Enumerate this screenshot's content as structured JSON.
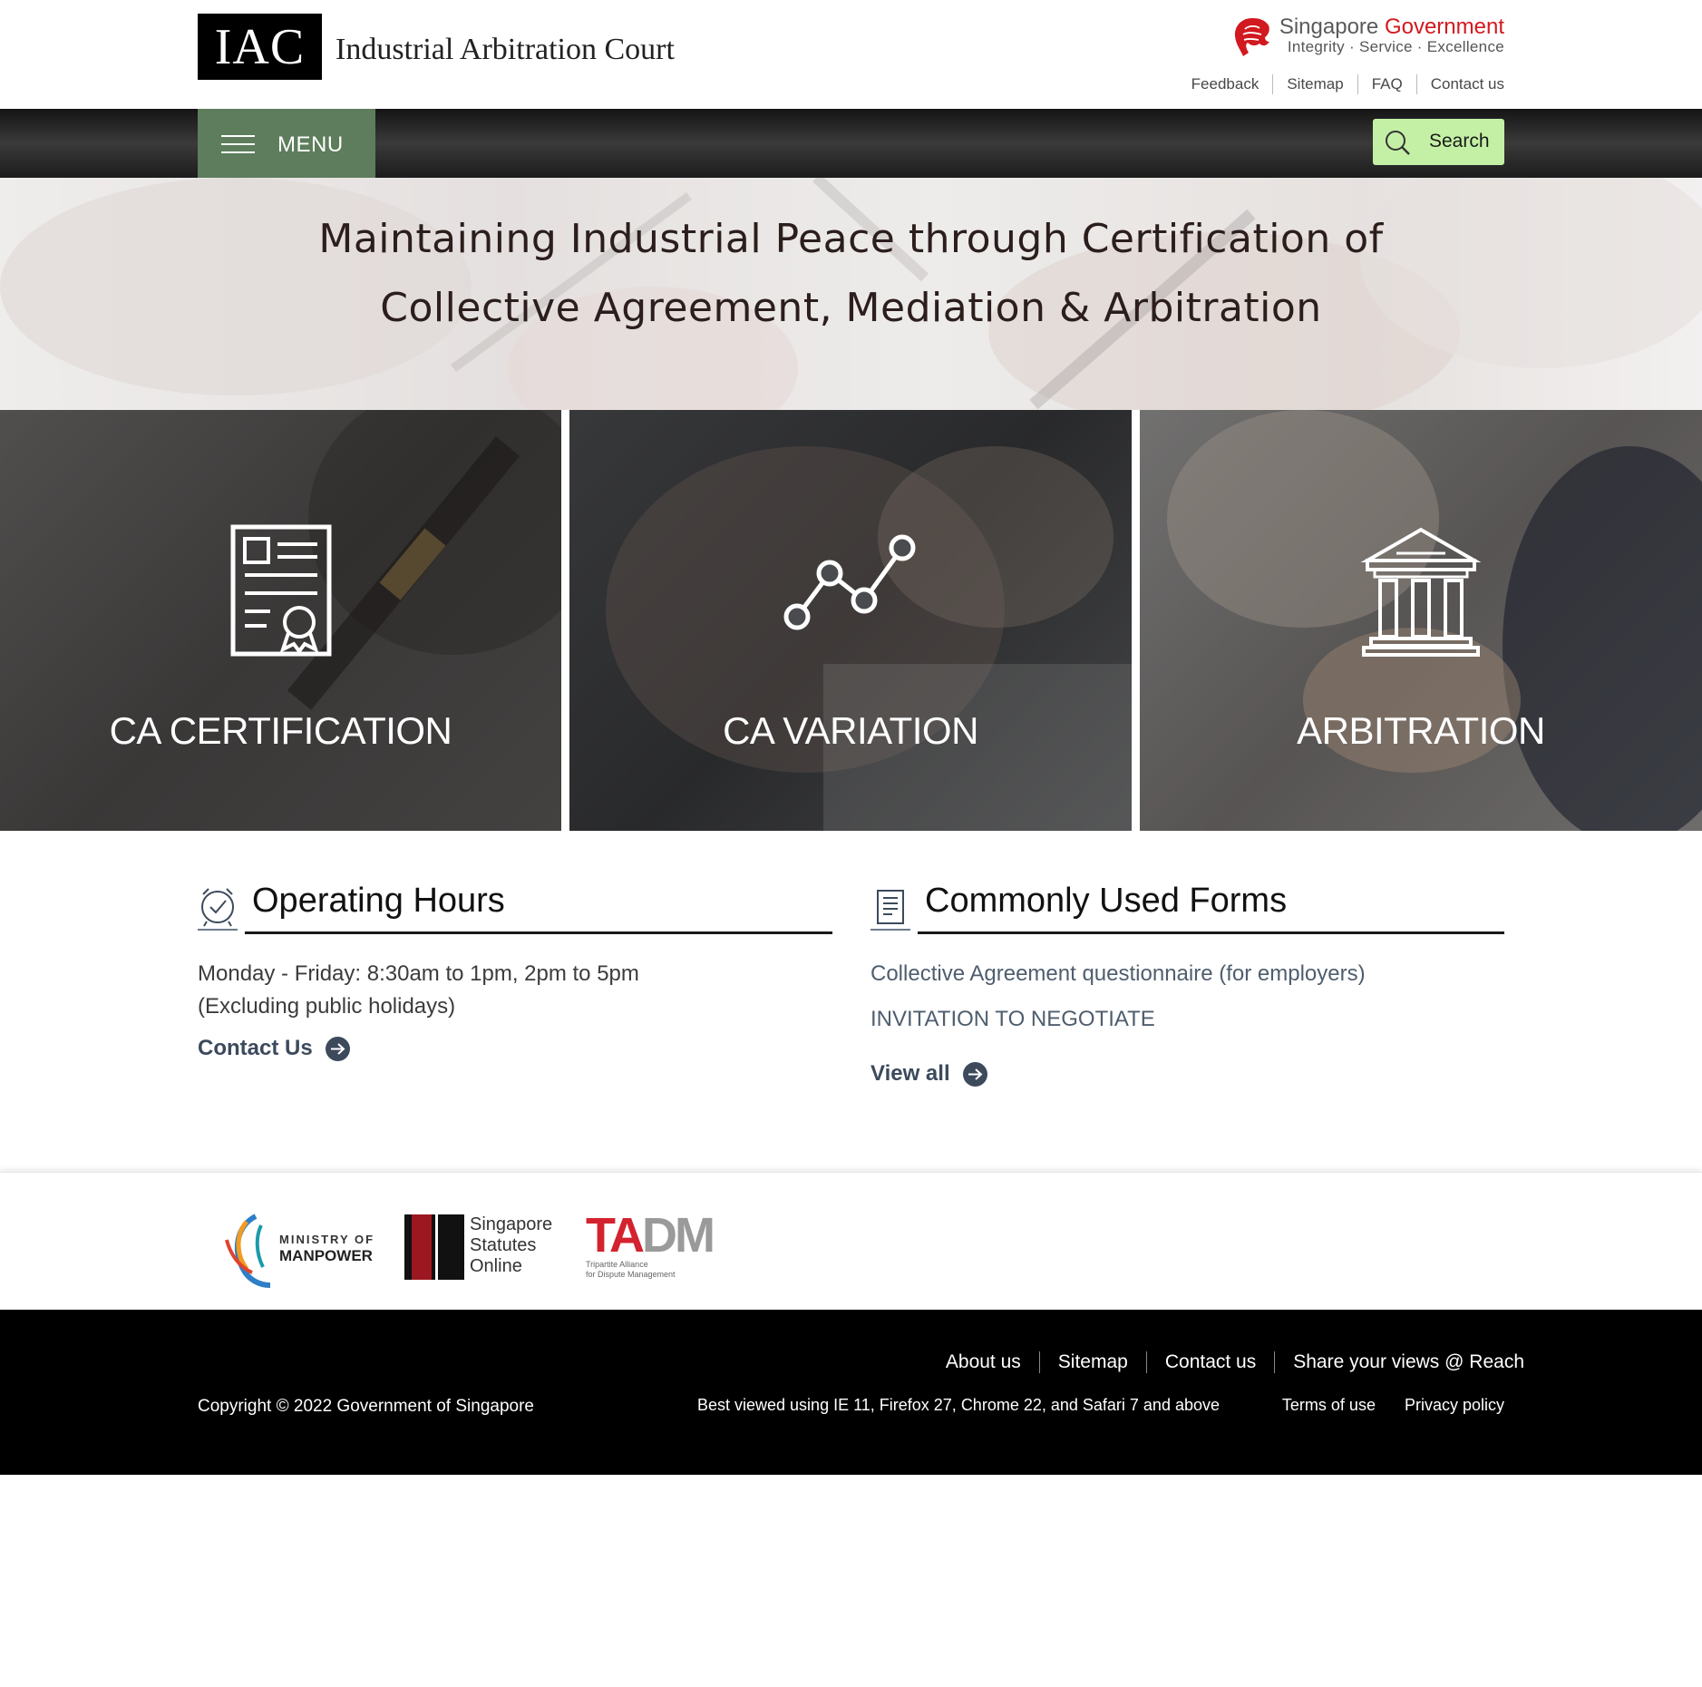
{
  "header": {
    "logo_abbr": "IAC",
    "logo_name": "Industrial Arbitration Court",
    "sg_gov": {
      "title_plain": "Singapore",
      "title_red": "Government",
      "tagline": "Integrity · Service · Excellence"
    },
    "util_links": [
      "Feedback",
      "Sitemap",
      "FAQ",
      "Contact us"
    ]
  },
  "nav": {
    "menu_label": "MENU",
    "search_label": "Search"
  },
  "hero": {
    "line1": "Maintaining Industrial Peace through Certification of",
    "line2": "Collective Agreement, Mediation & Arbitration"
  },
  "tiles": [
    {
      "label": "CA CERTIFICATION",
      "icon": "certificate-icon"
    },
    {
      "label": "CA VARIATION",
      "icon": "line-graph-icon"
    },
    {
      "label": "ARBITRATION",
      "icon": "courthouse-icon"
    }
  ],
  "operating_hours": {
    "title": "Operating Hours",
    "line1": "Monday - Friday: 8:30am to 1pm, 2pm to 5pm",
    "line2": "(Excluding public holidays)",
    "link": "Contact Us"
  },
  "forms": {
    "title": "Commonly Used Forms",
    "items": [
      "Collective Agreement questionnaire (for employers)",
      "INVITATION TO NEGOTIATE"
    ],
    "link": "View all"
  },
  "partners": {
    "mom": {
      "line1": "MINISTRY OF",
      "line2": "MANPOWER"
    },
    "sso": {
      "line1": "Singapore",
      "line2": "Statutes",
      "line3": "Online"
    },
    "tadm": {
      "abbr_ta": "TA",
      "abbr_dm": "DM",
      "line1": "Tripartite Alliance",
      "line2": "for Dispute Management"
    }
  },
  "footer": {
    "links": [
      "About us",
      "Sitemap",
      "Contact us",
      "Share your views @ Reach"
    ],
    "copyright": "Copyright © 2022 Government of Singapore",
    "best_viewed": "Best viewed using IE 11, Firefox 27, Chrome 22, and Safari 7 and above",
    "legal": [
      "Terms of use",
      "Privacy policy"
    ]
  },
  "colors": {
    "menu_green": "#5d7d5c",
    "search_green": "#c4f0a6",
    "gov_red": "#d1191f",
    "link_slate": "#3c4a5c"
  }
}
